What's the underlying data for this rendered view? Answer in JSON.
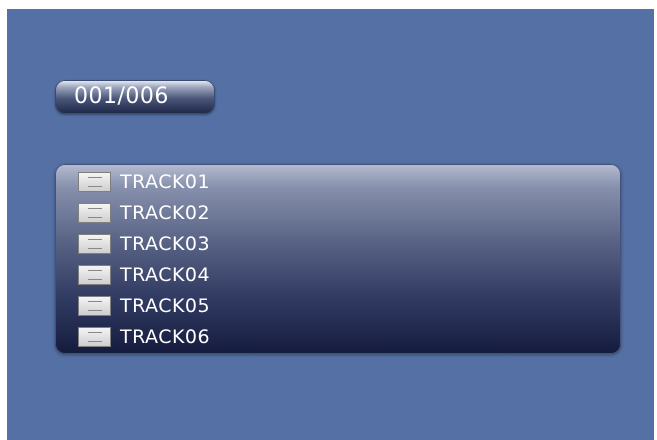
{
  "counter": {
    "text": "001/006"
  },
  "files": [
    {
      "name": "TRACK01",
      "icon": "avi-file-icon"
    },
    {
      "name": "TRACK02",
      "icon": "avi-file-icon"
    },
    {
      "name": "TRACK03",
      "icon": "avi-file-icon"
    },
    {
      "name": "TRACK04",
      "icon": "avi-file-icon"
    },
    {
      "name": "TRACK05",
      "icon": "avi-file-icon"
    },
    {
      "name": "TRACK06",
      "icon": "avi-file-icon"
    }
  ],
  "colors": {
    "background": "#5470a4",
    "text": "#ffffff"
  }
}
